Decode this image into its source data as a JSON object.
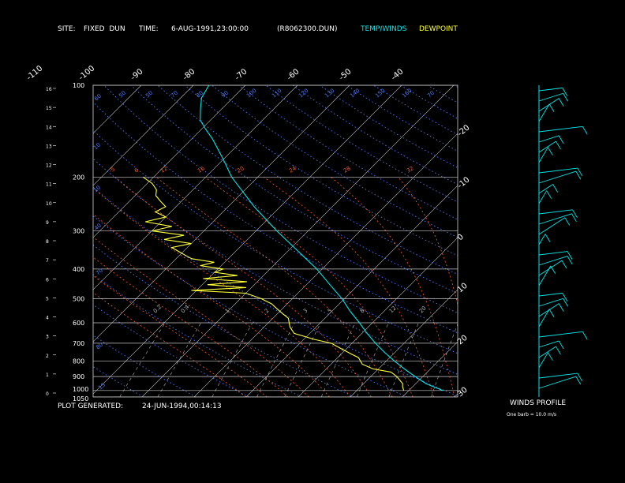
{
  "header": {
    "site_label": "SITE:",
    "site_value": "FIXED  DUN",
    "time_label": "TIME:",
    "time_value": "6-AUG-1991,23:00:00",
    "file_id": "(R8062300.DUN)",
    "legend_temp": "TEMP/WINDS",
    "legend_dewpoint": "DEWPOINT"
  },
  "footer": {
    "generated_label": "PLOT GENERATED:",
    "generated_value": "24-JUN-1994,00:14:13",
    "winds_title": "WINDS PROFILE",
    "barb_note": "One barb = 10.0 m/s"
  },
  "colors": {
    "background": "#000000",
    "temp": "#00e6e6",
    "dewpoint": "#ffff33",
    "isotherm": "#c8c8c8",
    "dry_adiabat": "#4c7cff",
    "moist_adiabat": "#ff5a28",
    "isobar": "#c8c8c8",
    "mixing_ratio": "#b4b4b4",
    "header_text": "#ffffff"
  },
  "chart_data": {
    "type": "line",
    "subtype": "skew-t log-p",
    "pressure_ticks": [
      100,
      200,
      300,
      400,
      500,
      600,
      700,
      800,
      900,
      1000,
      1050
    ],
    "pressure_labels": [
      "100",
      "200",
      "300",
      "400",
      "500",
      "600",
      "700",
      "800",
      "900",
      "1000",
      "1050"
    ],
    "height_ticks_km": [
      0,
      1,
      2,
      3,
      4,
      5,
      6,
      7,
      8,
      9,
      10,
      11,
      12,
      13,
      14,
      15,
      16
    ],
    "height_labels": [
      "0",
      "1",
      "2",
      "3",
      "4",
      "5",
      "6",
      "7",
      "8",
      "9",
      "10",
      "11",
      "12",
      "13",
      "14",
      "15",
      "16"
    ],
    "temp_top_labels": [
      "-110",
      "-100",
      "-90",
      "-80",
      "-70",
      "-60",
      "-50",
      "-40"
    ],
    "temp_right_labels": [
      "-30",
      "-20",
      "-10",
      "0",
      "10",
      "20",
      "30"
    ],
    "dry_adiabat_labels": [
      "60",
      "50",
      "50",
      "70",
      "80",
      "90",
      "100",
      "110",
      "120",
      "130",
      "140",
      "150",
      "160",
      "70",
      "10",
      "10",
      "40",
      "70",
      "80",
      "15"
    ],
    "moist_adiabat_labels": [
      "-5",
      "6",
      "12",
      "16",
      "20",
      "24",
      "28",
      "32"
    ],
    "mixing_ratio_labels": [
      "0.2",
      "0.4",
      "1",
      "2",
      "3",
      "5",
      "8",
      "12",
      "20"
    ],
    "temperature_profile": [
      [
        1000,
        26.5
      ],
      [
        950,
        22
      ],
      [
        900,
        18.5
      ],
      [
        850,
        15
      ],
      [
        800,
        11.5
      ],
      [
        750,
        8
      ],
      [
        700,
        4.5
      ],
      [
        650,
        1
      ],
      [
        600,
        -2.5
      ],
      [
        550,
        -6.5
      ],
      [
        500,
        -10.5
      ],
      [
        450,
        -15.5
      ],
      [
        400,
        -21
      ],
      [
        350,
        -28
      ],
      [
        300,
        -36
      ],
      [
        250,
        -45
      ],
      [
        200,
        -55
      ],
      [
        175,
        -60
      ],
      [
        150,
        -66
      ],
      [
        140,
        -69
      ],
      [
        130,
        -72
      ],
      [
        120,
        -74
      ],
      [
        110,
        -76
      ],
      [
        100,
        -77
      ]
    ],
    "dewpoint_profile": [
      [
        1000,
        19
      ],
      [
        970,
        18
      ],
      [
        950,
        17.5
      ],
      [
        900,
        15
      ],
      [
        870,
        13
      ],
      [
        850,
        9
      ],
      [
        820,
        6
      ],
      [
        800,
        5
      ],
      [
        780,
        4
      ],
      [
        760,
        2
      ],
      [
        730,
        -1
      ],
      [
        700,
        -4
      ],
      [
        680,
        -8
      ],
      [
        650,
        -13
      ],
      [
        620,
        -15
      ],
      [
        600,
        -16
      ],
      [
        580,
        -17
      ],
      [
        560,
        -19
      ],
      [
        540,
        -21
      ],
      [
        520,
        -23
      ],
      [
        500,
        -26
      ],
      [
        480,
        -30
      ],
      [
        470,
        -41
      ],
      [
        460,
        -31
      ],
      [
        450,
        -39
      ],
      [
        440,
        -32
      ],
      [
        430,
        -41
      ],
      [
        420,
        -35
      ],
      [
        410,
        -40
      ],
      [
        400,
        -39
      ],
      [
        390,
        -44
      ],
      [
        380,
        -42
      ],
      [
        370,
        -47
      ],
      [
        360,
        -49
      ],
      [
        350,
        -51
      ],
      [
        340,
        -53
      ],
      [
        330,
        -50
      ],
      [
        320,
        -56
      ],
      [
        310,
        -53
      ],
      [
        300,
        -60
      ],
      [
        290,
        -57
      ],
      [
        280,
        -63
      ],
      [
        270,
        -60
      ],
      [
        260,
        -63
      ],
      [
        250,
        -62
      ],
      [
        240,
        -64
      ],
      [
        230,
        -66
      ],
      [
        220,
        -67
      ],
      [
        210,
        -69
      ],
      [
        200,
        -72
      ]
    ],
    "axis": {
      "p_min": 100,
      "p_max": 1050,
      "p_scale": "log"
    }
  }
}
